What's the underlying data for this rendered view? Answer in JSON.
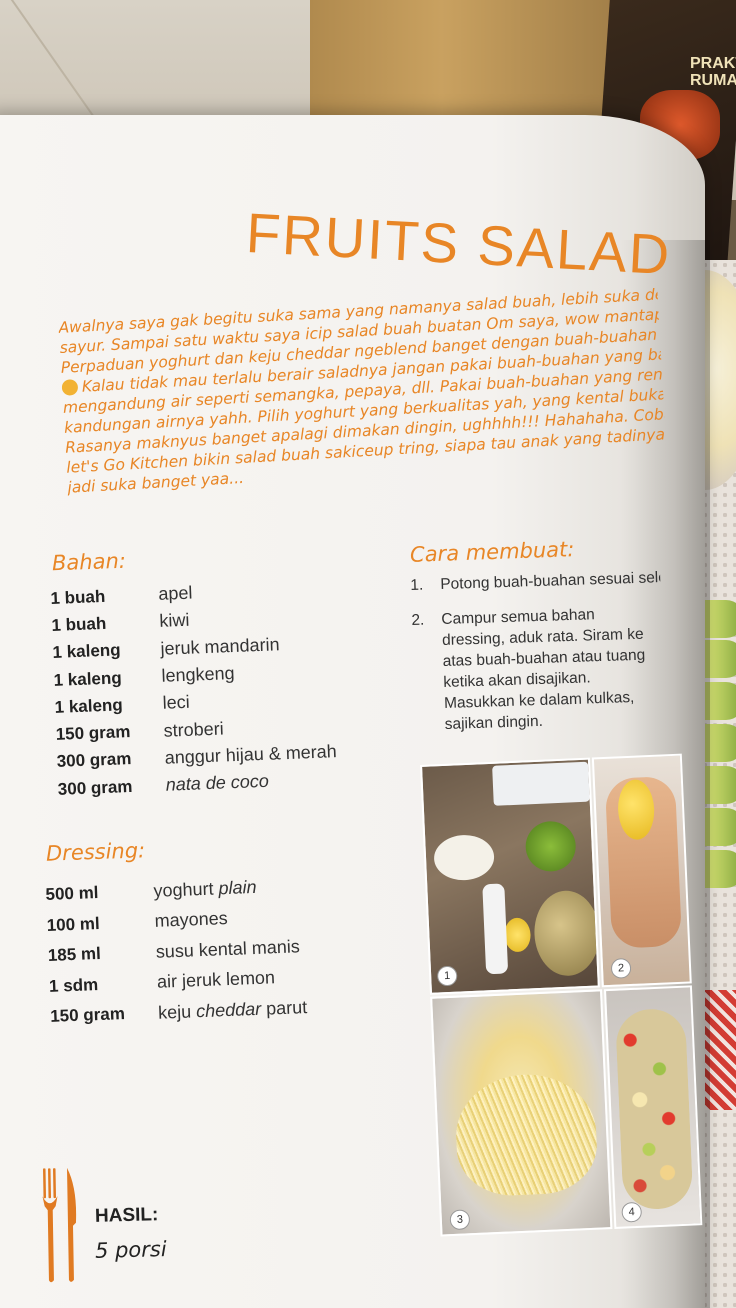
{
  "recipe": {
    "title": "FRUITS SALAD",
    "intro_lines": [
      "Awalnya saya gak begitu suka sama yang namanya salad buah, lebih suka dengan",
      "sayur. Sampai satu waktu saya icip salad buah buatan Om saya, wow mantap banget",
      "Perpaduan yoghurt dan keju cheddar ngeblend banget dengan buah-buahan banget",
      "Kalau tidak mau terlalu berair saladnya jangan pakai buah-buahan yang banyak",
      "mengandung air seperti semangka, pepaya, dll. Pakai buah-buahan yang rendah",
      "kandungan airnya yahh. Pilih yoghurt yang berkualitas yah, yang kental bukan yang",
      "Rasanya maknyus banget apalagi dimakan dingin, ughhhh!!! Hahahaha. Coba deh",
      "let's Go Kitchen bikin salad buah sakiceup tring, siapa tau anak yang tadinya gak suka",
      "jadi suka banget yaa..."
    ],
    "bahan_title": "Bahan:",
    "bahan": [
      {
        "qty": "1 buah",
        "name": "apel"
      },
      {
        "qty": "1 buah",
        "name": "kiwi"
      },
      {
        "qty": "1 kaleng",
        "name": "jeruk mandarin"
      },
      {
        "qty": "1 kaleng",
        "name": "lengkeng"
      },
      {
        "qty": "1 kaleng",
        "name": "leci"
      },
      {
        "qty": "150 gram",
        "name": "stroberi"
      },
      {
        "qty": "300 gram",
        "name": "anggur hijau & merah"
      },
      {
        "qty": "300 gram",
        "name": "nata de coco",
        "italic": true
      }
    ],
    "dressing_title": "Dressing:",
    "dressing": [
      {
        "qty": "500 ml",
        "name": "yoghurt ",
        "name_italic": "plain"
      },
      {
        "qty": "100 ml",
        "name": "mayones"
      },
      {
        "qty": "185 ml",
        "name": "susu kental manis"
      },
      {
        "qty": "1 sdm",
        "name": "air jeruk lemon"
      },
      {
        "qty": "150 gram",
        "name": "keju ",
        "name_italic": "cheddar",
        "name_after": " parut"
      }
    ],
    "cara_title": "Cara membuat:",
    "steps": [
      {
        "num": "1.",
        "text": "Potong buah-buahan sesuai selera, sisihkan."
      },
      {
        "num": "2.",
        "text": "Campur semua bahan dressing, aduk rata. Siram ke atas buah-buahan atau tuang ketika akan disajikan. Masukkan ke dalam kulkas, sajikan dingin."
      }
    ],
    "photo_badges": [
      "1",
      "2",
      "3",
      "4"
    ],
    "hasil_label": "HASIL:",
    "hasil_value": "5 porsi",
    "accent_color": "#e88626"
  },
  "background_book": {
    "title": "PRAKTIS RUMAH"
  }
}
